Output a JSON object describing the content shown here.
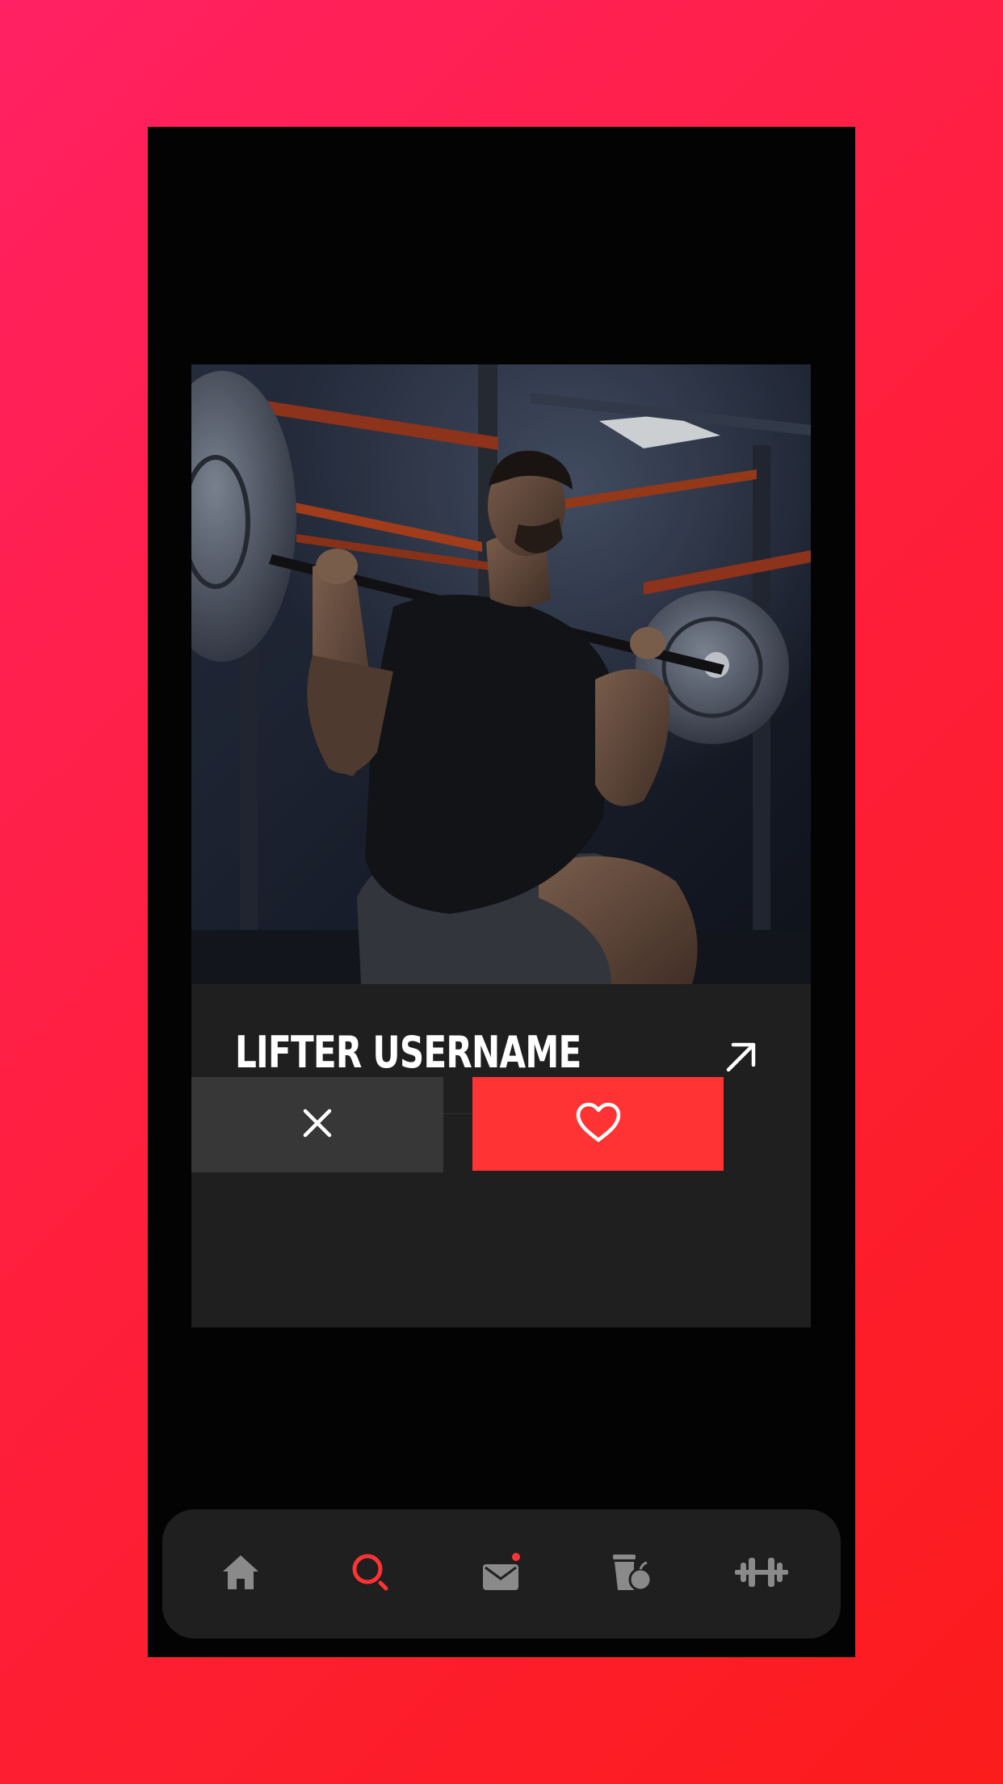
{
  "profile": {
    "username": "LIFTER USERNAME",
    "photo": "gym-lifter-squat-photo"
  },
  "icons": {
    "open": "arrow-up-right-icon",
    "reject": "close-icon",
    "like": "heart-icon"
  },
  "nav": {
    "active": "search",
    "items": [
      {
        "id": "home",
        "icon": "home-icon"
      },
      {
        "id": "search",
        "icon": "search-icon"
      },
      {
        "id": "messages",
        "icon": "mail-icon",
        "badge": true
      },
      {
        "id": "nutrition",
        "icon": "nutrition-icon"
      },
      {
        "id": "workouts",
        "icon": "dumbbell-icon"
      }
    ]
  },
  "colors": {
    "accent": "#ff3333",
    "background_gradient_start": "#ff2163",
    "background_gradient_end": "#fb1c1c",
    "card": "#1f1f1f",
    "reject_button": "#373737",
    "icon_inactive": "#8a8a8a"
  }
}
